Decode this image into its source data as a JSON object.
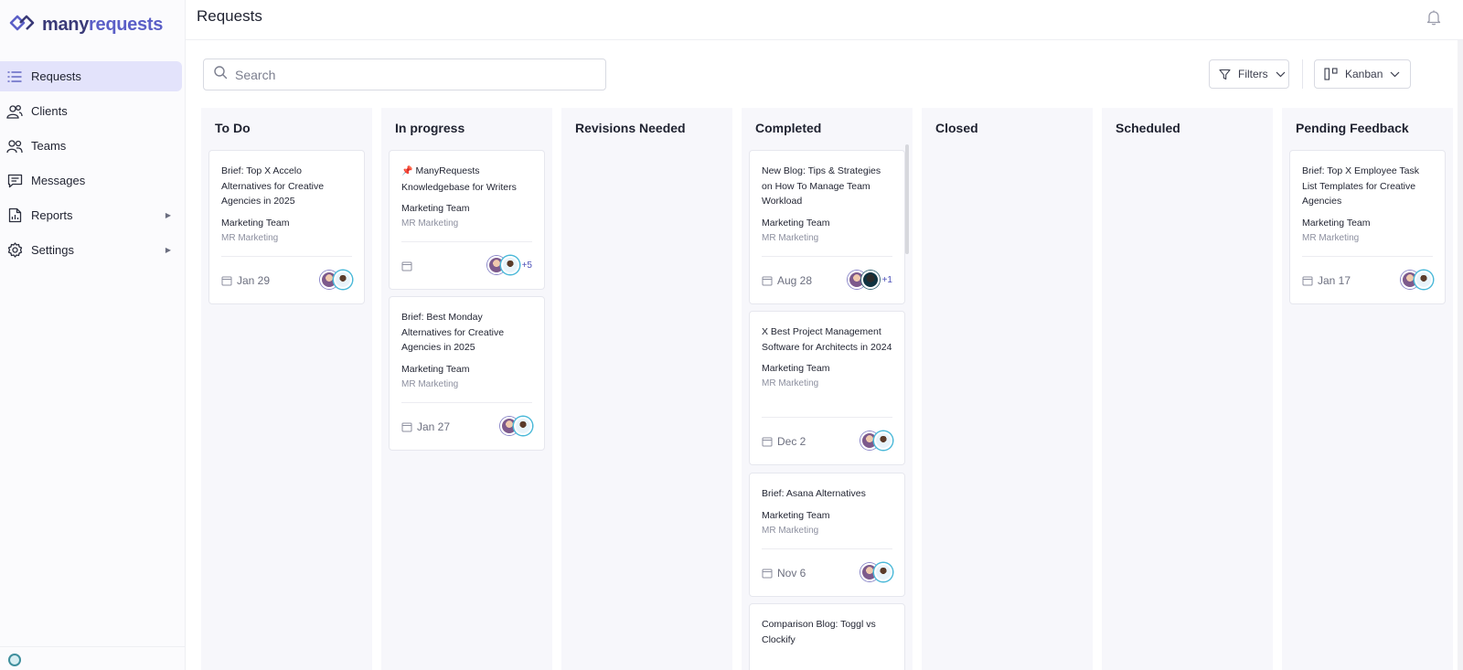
{
  "app": {
    "logo_part1": "many",
    "logo_part2": "requests",
    "page_title": "Requests"
  },
  "sidebar": {
    "items": [
      {
        "label": "Requests",
        "icon": "list-icon",
        "active": true
      },
      {
        "label": "Clients",
        "icon": "users-icon"
      },
      {
        "label": "Teams",
        "icon": "team-icon"
      },
      {
        "label": "Messages",
        "icon": "chat-icon"
      },
      {
        "label": "Reports",
        "icon": "report-icon",
        "submenu": true
      },
      {
        "label": "Settings",
        "icon": "gear-icon",
        "submenu": true
      }
    ]
  },
  "toolbar": {
    "search_placeholder": "Search",
    "filters_label": "Filters",
    "view_label": "Kanban"
  },
  "board": {
    "columns": [
      {
        "title": "To Do",
        "cards": [
          {
            "title": "Brief: Top X Accelo Alternatives for Creative Agencies in 2025",
            "team": "Marketing Team",
            "client": "MR Marketing",
            "date": "Jan 29"
          }
        ]
      },
      {
        "title": "In progress",
        "cards": [
          {
            "title": "ManyRequests Knowledgebase for Writers",
            "pinned": true,
            "team": "Marketing Team",
            "client": "MR Marketing",
            "date": "",
            "more": "+5"
          },
          {
            "title": "Brief: Best Monday Alternatives for Creative Agencies in 2025",
            "team": "Marketing Team",
            "client": "MR Marketing",
            "date": "Jan 27"
          }
        ]
      },
      {
        "title": "Revisions Needed",
        "cards": []
      },
      {
        "title": "Completed",
        "cards": [
          {
            "title": "New Blog: Tips & Strategies on How To Manage Team Workload",
            "team": "Marketing Team",
            "client": "MR Marketing",
            "date": "Aug 28",
            "more": "+1"
          },
          {
            "title": "X Best Project Management Software for Architects in 2024",
            "team": "Marketing Team",
            "client": "MR Marketing",
            "date": "Dec 2"
          },
          {
            "title": "Brief: Asana Alternatives",
            "team": "Marketing Team",
            "client": "MR Marketing",
            "date": "Nov 6"
          },
          {
            "title": "Comparison Blog: Toggl vs Clockify"
          }
        ]
      },
      {
        "title": "Closed",
        "cards": []
      },
      {
        "title": "Scheduled",
        "cards": []
      },
      {
        "title": "Pending Feedback",
        "cards": [
          {
            "title": "Brief: Top X Employee Task List Templates for Creative Agencies",
            "team": "Marketing Team",
            "client": "MR Marketing",
            "date": "Jan 17"
          }
        ]
      }
    ]
  },
  "colors": {
    "accent": "#5b5fc7",
    "active_nav": "#e3e3fb",
    "column_bg": "#f7f7fb"
  }
}
